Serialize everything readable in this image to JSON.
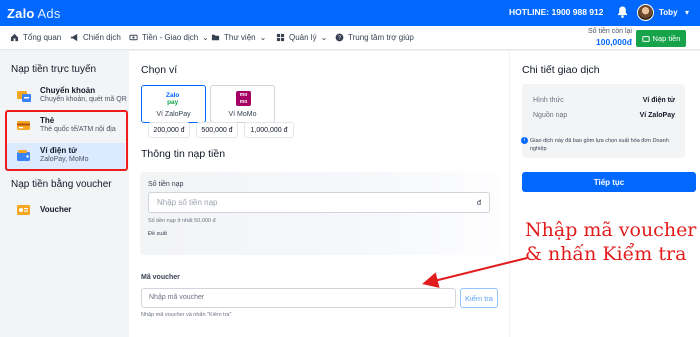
{
  "topbar": {
    "logo": "Zalo",
    "logo_suffix": "Ads",
    "hotline": "HOTLINE: 1900 988 912",
    "username": "Toby"
  },
  "nav": {
    "items": [
      {
        "label": "Tổng quan",
        "icon": "home-icon"
      },
      {
        "label": "Chiến dịch",
        "icon": "megaphone-icon"
      },
      {
        "label": "Tiền - Giao dịch",
        "icon": "money-icon"
      },
      {
        "label": "Thư viện",
        "icon": "folder-icon"
      },
      {
        "label": "Quản lý",
        "icon": "grid-icon"
      },
      {
        "label": "Trung tâm trợ giúp",
        "icon": "help-icon"
      }
    ],
    "balance_label": "Số tiền còn lại",
    "balance_value": "100,000đ",
    "topup_label": "Nạp tiền"
  },
  "sidebar": {
    "online_title": "Nạp tiền trực tuyến",
    "items": [
      {
        "title": "Chuyển khoản",
        "subtitle": "Chuyển khoản, quét mã QR",
        "icon": "bank-transfer-icon"
      },
      {
        "title": "Thẻ",
        "subtitle": "Thẻ quốc tế/ATM nội địa",
        "icon": "card-icon"
      },
      {
        "title": "Ví điện tử",
        "subtitle": "ZaloPay, MoMo",
        "icon": "wallet-icon"
      }
    ],
    "voucher_title": "Nạp tiền bằng voucher",
    "voucher_item": {
      "title": "Voucher",
      "icon": "voucher-icon"
    }
  },
  "main": {
    "choose_wallet_title": "Chọn ví",
    "wallets": [
      {
        "name": "Ví ZaloPay",
        "logo_top": "Zalo",
        "logo_bottom": "pay"
      },
      {
        "name": "Ví MoMo",
        "logo_top": "mo",
        "logo_bottom": "mo"
      }
    ],
    "topup_info_title": "Thông tin nạp tiền",
    "amount_label": "Số tiền nạp",
    "amount_placeholder": "Nhập số tiền nạp",
    "currency": "đ",
    "amount_min_hint": "Số tiền nạp ít nhất 50,000 đ",
    "suggest_label": "Đề xuất",
    "suggestions": [
      "200,000 đ",
      "500,000 đ",
      "1,000,000 đ"
    ],
    "voucher_label": "Mã voucher",
    "voucher_placeholder": "Nhập mã voucher",
    "check_button": "Kiểm tra",
    "voucher_hint": "Nhập mã voucher và nhấn \"Kiểm tra\""
  },
  "details": {
    "title": "Chi tiết giao dịch",
    "rows": [
      {
        "key": "Hình thức",
        "value": "Ví điện tử"
      },
      {
        "key": "Nguồn nạp",
        "value": "Ví ZaloPay"
      }
    ],
    "note": "Giao dịch này đã bao gồm lựa chọn xuất hóa đơn Doanh nghiệp",
    "continue_label": "Tiếp tục"
  },
  "annotation": {
    "line1": "Nhập mã voucher",
    "line2": "& nhấn Kiểm tra",
    "color": "#e11d1d"
  },
  "colors": {
    "primary": "#0068ff",
    "success": "#16a34a",
    "highlight": "#ef1c1c"
  }
}
